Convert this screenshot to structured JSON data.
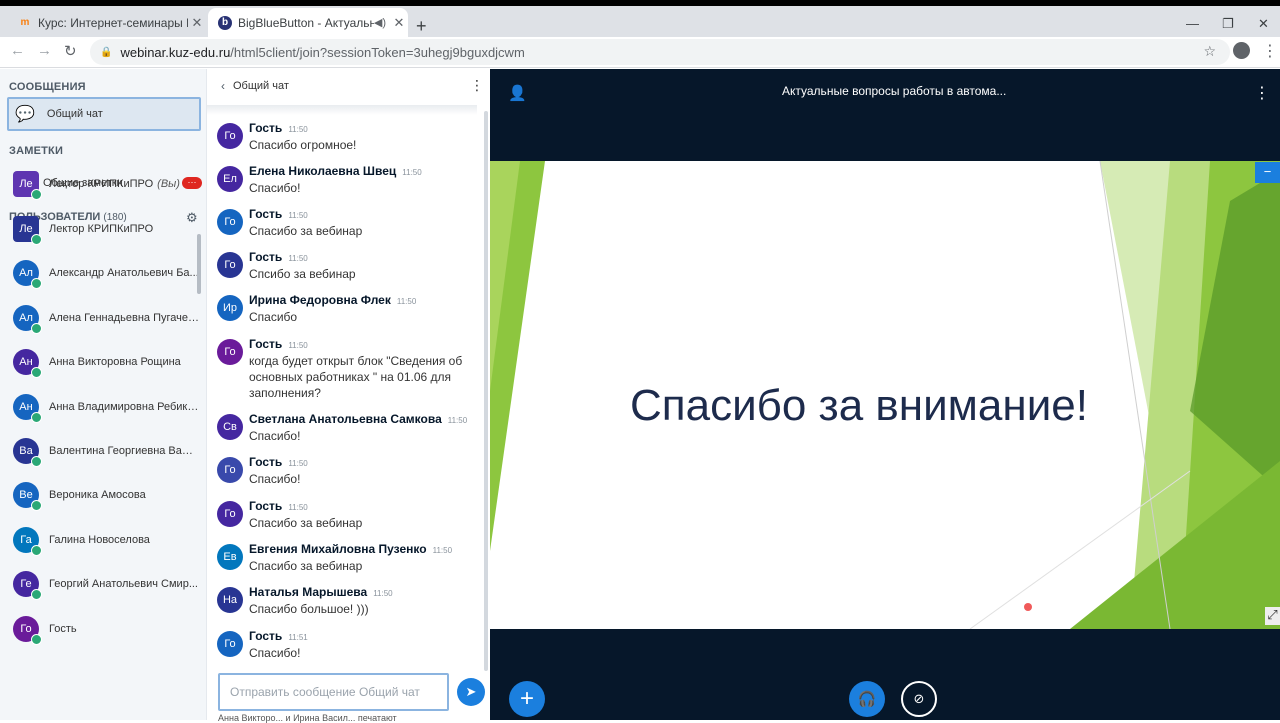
{
  "browser": {
    "tabs": [
      {
        "title": "Курс: Интернет-семинары КРИПКиПРО",
        "favicon": "moodle-icon"
      },
      {
        "title": "BigBlueButton - Актуальные вопросы",
        "favicon": "bbb-icon",
        "active": true
      }
    ],
    "url_host": "webinar.kuz-edu.ru",
    "url_rest": "/html5client/join?sessionToken=3uhegj9bguxdjcwm"
  },
  "sidebar": {
    "messages_title": "СООБЩЕНИЯ",
    "public_chat_label": "Общий чат",
    "notes_title": "ЗАМЕТКИ",
    "shared_notes_label": "Общие заметки",
    "notes_badge": "···",
    "users_title": "ПОЛЬЗОВАТЕЛИ",
    "users_count": "(180)",
    "users": [
      {
        "initials": "Ле",
        "name": "Лектор КРИПКиПРО",
        "suffix": "(Вы)",
        "color": "#5e35b1"
      },
      {
        "initials": "Ле",
        "name": "Лектор КРИПКиПРО",
        "suffix": "",
        "color": "#283593"
      },
      {
        "initials": "Ал",
        "name": "Александр Анатольевич Ба...",
        "suffix": "",
        "color": "#1565c0"
      },
      {
        "initials": "Ал",
        "name": "Алена Геннадьевна Пугачева",
        "suffix": "",
        "color": "#1565c0"
      },
      {
        "initials": "Ан",
        "name": "Анна Викторовна Рощина",
        "suffix": "",
        "color": "#4527a0"
      },
      {
        "initials": "Ан",
        "name": "Анна Владимировна Ребико...",
        "suffix": "",
        "color": "#1565c0"
      },
      {
        "initials": "Ва",
        "name": "Валентина Георгиевна Варе...",
        "suffix": "",
        "color": "#283593"
      },
      {
        "initials": "Ве",
        "name": "Вероника Амосова",
        "suffix": "",
        "color": "#1565c0"
      },
      {
        "initials": "Га",
        "name": "Галина Новоселова",
        "suffix": "",
        "color": "#0277bd"
      },
      {
        "initials": "Ге",
        "name": "Георгий Анатольевич Смир...",
        "suffix": "",
        "color": "#4527a0"
      },
      {
        "initials": "Го",
        "name": "Гость",
        "suffix": "",
        "color": "#6a1b9a"
      }
    ]
  },
  "chat": {
    "title": "Общий чат",
    "messages": [
      {
        "initials": "Го",
        "name": "Гость",
        "time": "11:50",
        "text": "Спасибо огромное!",
        "color": "#4527a0"
      },
      {
        "initials": "Ел",
        "name": "Елена Николаевна Швец",
        "time": "11:50",
        "text": "Спасибо!",
        "color": "#4527a0"
      },
      {
        "initials": "Го",
        "name": "Гость",
        "time": "11:50",
        "text": "Спасибо за вебинар",
        "color": "#1565c0"
      },
      {
        "initials": "Го",
        "name": "Гость",
        "time": "11:50",
        "text": "Спсибо за вебинар",
        "color": "#283593"
      },
      {
        "initials": "Ир",
        "name": "Ирина Федоровна Флек",
        "time": "11:50",
        "text": "Спасибо",
        "color": "#1565c0"
      },
      {
        "initials": "Го",
        "name": "Гость",
        "time": "11:50",
        "text": "когда будет открыт блок \"Сведения об основных работниках \" на 01.06 для заполнения?",
        "color": "#6a1b9a"
      },
      {
        "initials": "Св",
        "name": "Светлана Анатольевна Самкова",
        "time": "11:50",
        "text": "Спасибо!",
        "color": "#4527a0"
      },
      {
        "initials": "Го",
        "name": "Гость",
        "time": "11:50",
        "text": "Спасибо!",
        "color": "#3949ab"
      },
      {
        "initials": "Го",
        "name": "Гость",
        "time": "11:50",
        "text": "Спасибо за вебинар",
        "color": "#4527a0"
      },
      {
        "initials": "Ев",
        "name": "Евгения Михайловна Пузенко",
        "time": "11:50",
        "text": "Спасибо за вебинар",
        "color": "#0277bd"
      },
      {
        "initials": "На",
        "name": "Наталья Марышева",
        "time": "11:50",
        "text": "Спасибо большое! )))",
        "color": "#283593"
      },
      {
        "initials": "Го",
        "name": "Гость",
        "time": "11:51",
        "text": "Спасибо!",
        "color": "#1565c0"
      }
    ],
    "input_placeholder": "Отправить сообщение Общий чат",
    "typing": "Анна Викторо...   и Ирина Васил...   печатают"
  },
  "main": {
    "meeting_title": "Актуальные вопросы работы в автома...",
    "slide_text": "Спасибо за внимание!"
  },
  "colors": {
    "accent": "#1b7fde",
    "dark_bg": "#06172a",
    "slide_green": "#8dc63f"
  }
}
